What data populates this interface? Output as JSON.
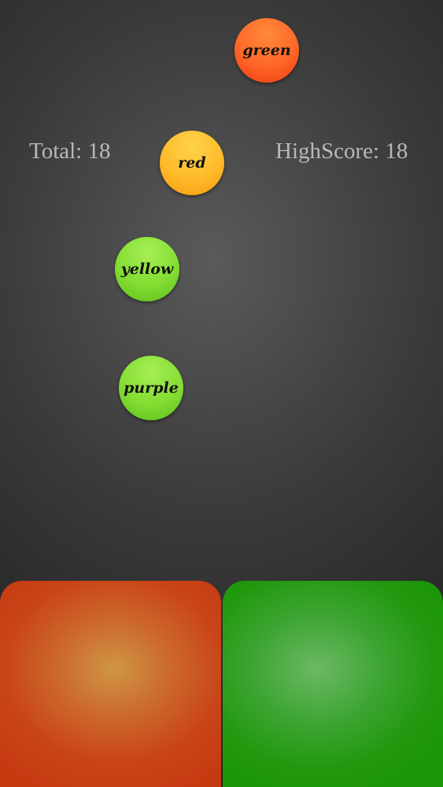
{
  "scoreboard": {
    "total": "Total: 18",
    "highscore": "HighScore: 18"
  },
  "balls": [
    {
      "label": "green",
      "color": "#ff6628"
    },
    {
      "label": "red",
      "color": "#ffbb2a"
    },
    {
      "label": "yellow",
      "color": "#84dd32"
    },
    {
      "label": "purple",
      "color": "#84dd32"
    }
  ],
  "pads": [
    {
      "color": "#c94418"
    },
    {
      "color": "#21980e"
    }
  ]
}
